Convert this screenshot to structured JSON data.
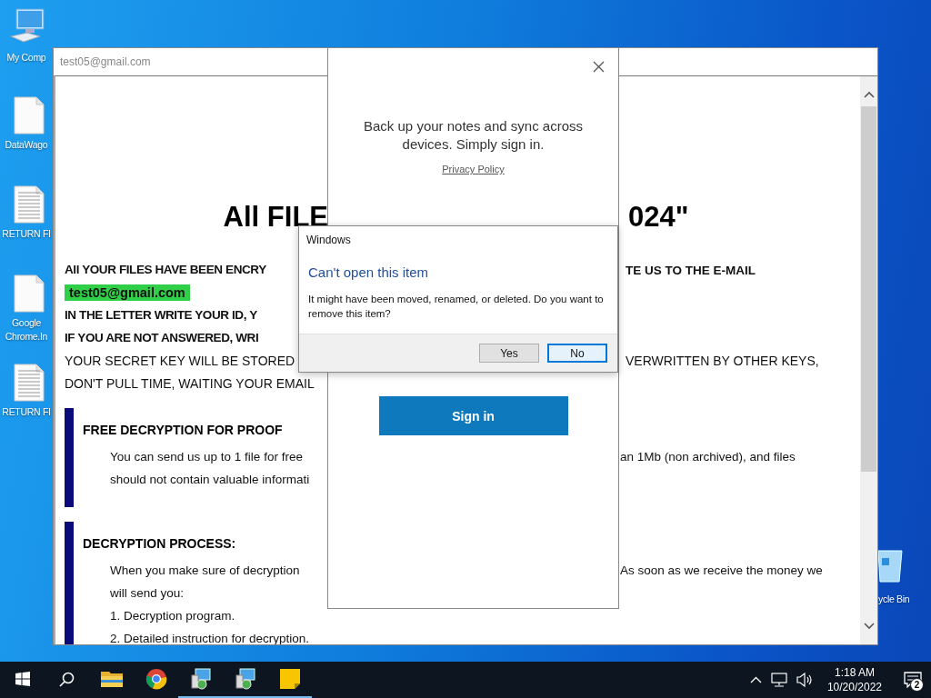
{
  "desktop": {
    "icons": [
      {
        "kind": "computer",
        "lines": [
          "My Comp"
        ]
      },
      {
        "kind": "blank",
        "lines": [
          "DataWago"
        ]
      },
      {
        "kind": "text",
        "lines": [
          "RETURN FI"
        ]
      },
      {
        "kind": "blank",
        "lines": [
          "Google",
          "Chrome.In"
        ]
      },
      {
        "kind": "text",
        "lines": [
          "RETURN FI"
        ]
      }
    ],
    "recycle_bin": {
      "label": "ycle Bin"
    }
  },
  "note_window": {
    "title": "test05@gmail.com",
    "heading": {
      "left": "All FILE",
      "right": "024\""
    },
    "lines": [
      {
        "kind": "bold",
        "left": "All YOUR FILES HAVE BEEN ENCRY",
        "right": "TE US TO THE E-MAIL"
      },
      {
        "kind": "tag",
        "left": "test05@gmail.com"
      },
      {
        "kind": "bold",
        "left": "IN THE LETTER WRITE YOUR ID, Y"
      },
      {
        "kind": "bold",
        "left": "IF YOU ARE NOT ANSWERED, WRI"
      },
      {
        "kind": "plain",
        "left": "YOUR SECRET KEY WILL BE STORED",
        "right": "VERWRITTEN BY OTHER KEYS,"
      },
      {
        "kind": "plain",
        "left": "DON'T PULL TIME, WAITING YOUR EMAIL"
      }
    ],
    "sections": [
      {
        "heading": "FREE DECRYPTION FOR PROOF",
        "lines": [
          {
            "left": "You can send us up to 1 file for free",
            "right": "an 1Mb (non archived), and files"
          },
          {
            "left": "should not contain valuable informati"
          }
        ]
      },
      {
        "heading": "DECRYPTION PROCESS:",
        "lines": [
          {
            "left": "When you make sure of decryption",
            "right": "As soon as we receive the money we"
          },
          {
            "left": "will send you:"
          },
          {
            "left": "1. Decryption program."
          },
          {
            "left": "2. Detailed instruction for decryption."
          }
        ]
      }
    ]
  },
  "sign_in_panel": {
    "message": "Back up your notes and sync across devices. Simply sign in.",
    "link": "Privacy Policy",
    "button": "Sign in"
  },
  "dialog": {
    "title": "Windows",
    "heading": "Can't open this item",
    "message": "It might have been moved, renamed, or deleted. Do you want to remove this item?",
    "buttons": [
      {
        "label": "Yes",
        "selected": false
      },
      {
        "label": "No",
        "selected": true
      }
    ]
  },
  "taskbar": {
    "apps": [
      {
        "kind": "start",
        "running": false
      },
      {
        "kind": "search",
        "running": false
      },
      {
        "kind": "folder",
        "running": false
      },
      {
        "kind": "browser",
        "running": false
      },
      {
        "kind": "installer",
        "running": true
      },
      {
        "kind": "installer",
        "running": true
      },
      {
        "kind": "notes",
        "running": true
      }
    ],
    "time": "1:18 AM",
    "date": "10/20/2022",
    "notification_count": "2"
  }
}
